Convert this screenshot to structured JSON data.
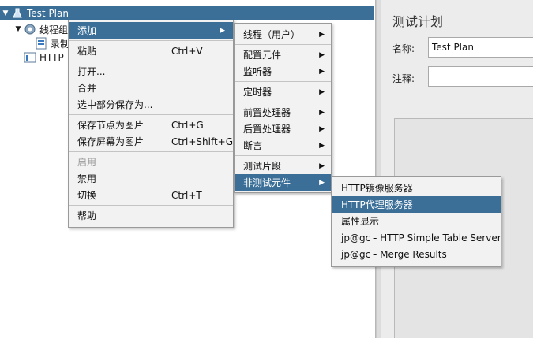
{
  "tree": {
    "root": "Test Plan",
    "items": [
      {
        "label": "线程组"
      },
      {
        "label": "录制"
      },
      {
        "label": "HTTP"
      }
    ]
  },
  "right_panel": {
    "title": "测试计划",
    "name_label": "名称:",
    "name_value": "Test Plan",
    "comment_label": "注释:",
    "comment_value": ""
  },
  "context_menu": {
    "items": [
      {
        "label": "添加",
        "shortcut": "",
        "submenu": true,
        "active": true
      },
      {
        "label": "粘贴",
        "shortcut": "Ctrl+V"
      },
      {
        "label": "打开...",
        "shortcut": ""
      },
      {
        "label": "合并",
        "shortcut": ""
      },
      {
        "label": "选中部分保存为...",
        "shortcut": ""
      },
      {
        "label": "保存节点为图片",
        "shortcut": "Ctrl+G"
      },
      {
        "label": "保存屏幕为图片",
        "shortcut": "Ctrl+Shift+G"
      },
      {
        "label": "启用",
        "shortcut": "",
        "disabled": true
      },
      {
        "label": "禁用",
        "shortcut": ""
      },
      {
        "label": "切换",
        "shortcut": "Ctrl+T"
      },
      {
        "label": "帮助",
        "shortcut": ""
      }
    ]
  },
  "add_submenu": {
    "items": [
      {
        "label": "线程（用户）"
      },
      {
        "label": "配置元件"
      },
      {
        "label": "监听器"
      },
      {
        "label": "定时器"
      },
      {
        "label": "前置处理器"
      },
      {
        "label": "后置处理器"
      },
      {
        "label": "断言"
      },
      {
        "label": "测试片段"
      },
      {
        "label": "非测试元件",
        "active": true
      }
    ]
  },
  "non_test_submenu": {
    "items": [
      {
        "label": "HTTP镜像服务器"
      },
      {
        "label": "HTTP代理服务器",
        "active": true
      },
      {
        "label": "属性显示"
      },
      {
        "label": "jp@gc - HTTP Simple Table Server"
      },
      {
        "label": "jp@gc - Merge Results"
      }
    ]
  },
  "colors": {
    "selection": "#3b6f98",
    "menu_bg": "#f2f2f2",
    "disabled_text": "#9a9a9a"
  },
  "icons": {
    "expand": "triangle-down",
    "test_plan": "flask-icon",
    "thread_group": "gear-icon",
    "recorder": "document-icon",
    "http": "http-icon",
    "submenu": "triangle-right"
  }
}
